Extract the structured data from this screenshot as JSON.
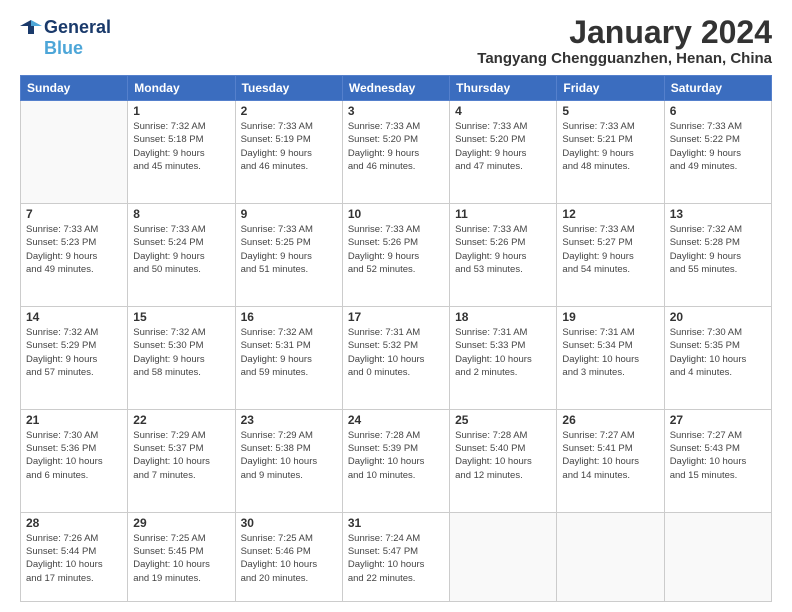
{
  "logo": {
    "line1": "General",
    "line2": "Blue"
  },
  "title": {
    "month_year": "January 2024",
    "location": "Tangyang Chengguanzhen, Henan, China"
  },
  "weekdays": [
    "Sunday",
    "Monday",
    "Tuesday",
    "Wednesday",
    "Thursday",
    "Friday",
    "Saturday"
  ],
  "weeks": [
    [
      {
        "day": "",
        "info": ""
      },
      {
        "day": "1",
        "info": "Sunrise: 7:32 AM\nSunset: 5:18 PM\nDaylight: 9 hours\nand 45 minutes."
      },
      {
        "day": "2",
        "info": "Sunrise: 7:33 AM\nSunset: 5:19 PM\nDaylight: 9 hours\nand 46 minutes."
      },
      {
        "day": "3",
        "info": "Sunrise: 7:33 AM\nSunset: 5:20 PM\nDaylight: 9 hours\nand 46 minutes."
      },
      {
        "day": "4",
        "info": "Sunrise: 7:33 AM\nSunset: 5:20 PM\nDaylight: 9 hours\nand 47 minutes."
      },
      {
        "day": "5",
        "info": "Sunrise: 7:33 AM\nSunset: 5:21 PM\nDaylight: 9 hours\nand 48 minutes."
      },
      {
        "day": "6",
        "info": "Sunrise: 7:33 AM\nSunset: 5:22 PM\nDaylight: 9 hours\nand 49 minutes."
      }
    ],
    [
      {
        "day": "7",
        "info": "Sunrise: 7:33 AM\nSunset: 5:23 PM\nDaylight: 9 hours\nand 49 minutes."
      },
      {
        "day": "8",
        "info": "Sunrise: 7:33 AM\nSunset: 5:24 PM\nDaylight: 9 hours\nand 50 minutes."
      },
      {
        "day": "9",
        "info": "Sunrise: 7:33 AM\nSunset: 5:25 PM\nDaylight: 9 hours\nand 51 minutes."
      },
      {
        "day": "10",
        "info": "Sunrise: 7:33 AM\nSunset: 5:26 PM\nDaylight: 9 hours\nand 52 minutes."
      },
      {
        "day": "11",
        "info": "Sunrise: 7:33 AM\nSunset: 5:26 PM\nDaylight: 9 hours\nand 53 minutes."
      },
      {
        "day": "12",
        "info": "Sunrise: 7:33 AM\nSunset: 5:27 PM\nDaylight: 9 hours\nand 54 minutes."
      },
      {
        "day": "13",
        "info": "Sunrise: 7:32 AM\nSunset: 5:28 PM\nDaylight: 9 hours\nand 55 minutes."
      }
    ],
    [
      {
        "day": "14",
        "info": "Sunrise: 7:32 AM\nSunset: 5:29 PM\nDaylight: 9 hours\nand 57 minutes."
      },
      {
        "day": "15",
        "info": "Sunrise: 7:32 AM\nSunset: 5:30 PM\nDaylight: 9 hours\nand 58 minutes."
      },
      {
        "day": "16",
        "info": "Sunrise: 7:32 AM\nSunset: 5:31 PM\nDaylight: 9 hours\nand 59 minutes."
      },
      {
        "day": "17",
        "info": "Sunrise: 7:31 AM\nSunset: 5:32 PM\nDaylight: 10 hours\nand 0 minutes."
      },
      {
        "day": "18",
        "info": "Sunrise: 7:31 AM\nSunset: 5:33 PM\nDaylight: 10 hours\nand 2 minutes."
      },
      {
        "day": "19",
        "info": "Sunrise: 7:31 AM\nSunset: 5:34 PM\nDaylight: 10 hours\nand 3 minutes."
      },
      {
        "day": "20",
        "info": "Sunrise: 7:30 AM\nSunset: 5:35 PM\nDaylight: 10 hours\nand 4 minutes."
      }
    ],
    [
      {
        "day": "21",
        "info": "Sunrise: 7:30 AM\nSunset: 5:36 PM\nDaylight: 10 hours\nand 6 minutes."
      },
      {
        "day": "22",
        "info": "Sunrise: 7:29 AM\nSunset: 5:37 PM\nDaylight: 10 hours\nand 7 minutes."
      },
      {
        "day": "23",
        "info": "Sunrise: 7:29 AM\nSunset: 5:38 PM\nDaylight: 10 hours\nand 9 minutes."
      },
      {
        "day": "24",
        "info": "Sunrise: 7:28 AM\nSunset: 5:39 PM\nDaylight: 10 hours\nand 10 minutes."
      },
      {
        "day": "25",
        "info": "Sunrise: 7:28 AM\nSunset: 5:40 PM\nDaylight: 10 hours\nand 12 minutes."
      },
      {
        "day": "26",
        "info": "Sunrise: 7:27 AM\nSunset: 5:41 PM\nDaylight: 10 hours\nand 14 minutes."
      },
      {
        "day": "27",
        "info": "Sunrise: 7:27 AM\nSunset: 5:43 PM\nDaylight: 10 hours\nand 15 minutes."
      }
    ],
    [
      {
        "day": "28",
        "info": "Sunrise: 7:26 AM\nSunset: 5:44 PM\nDaylight: 10 hours\nand 17 minutes."
      },
      {
        "day": "29",
        "info": "Sunrise: 7:25 AM\nSunset: 5:45 PM\nDaylight: 10 hours\nand 19 minutes."
      },
      {
        "day": "30",
        "info": "Sunrise: 7:25 AM\nSunset: 5:46 PM\nDaylight: 10 hours\nand 20 minutes."
      },
      {
        "day": "31",
        "info": "Sunrise: 7:24 AM\nSunset: 5:47 PM\nDaylight: 10 hours\nand 22 minutes."
      },
      {
        "day": "",
        "info": ""
      },
      {
        "day": "",
        "info": ""
      },
      {
        "day": "",
        "info": ""
      }
    ]
  ]
}
